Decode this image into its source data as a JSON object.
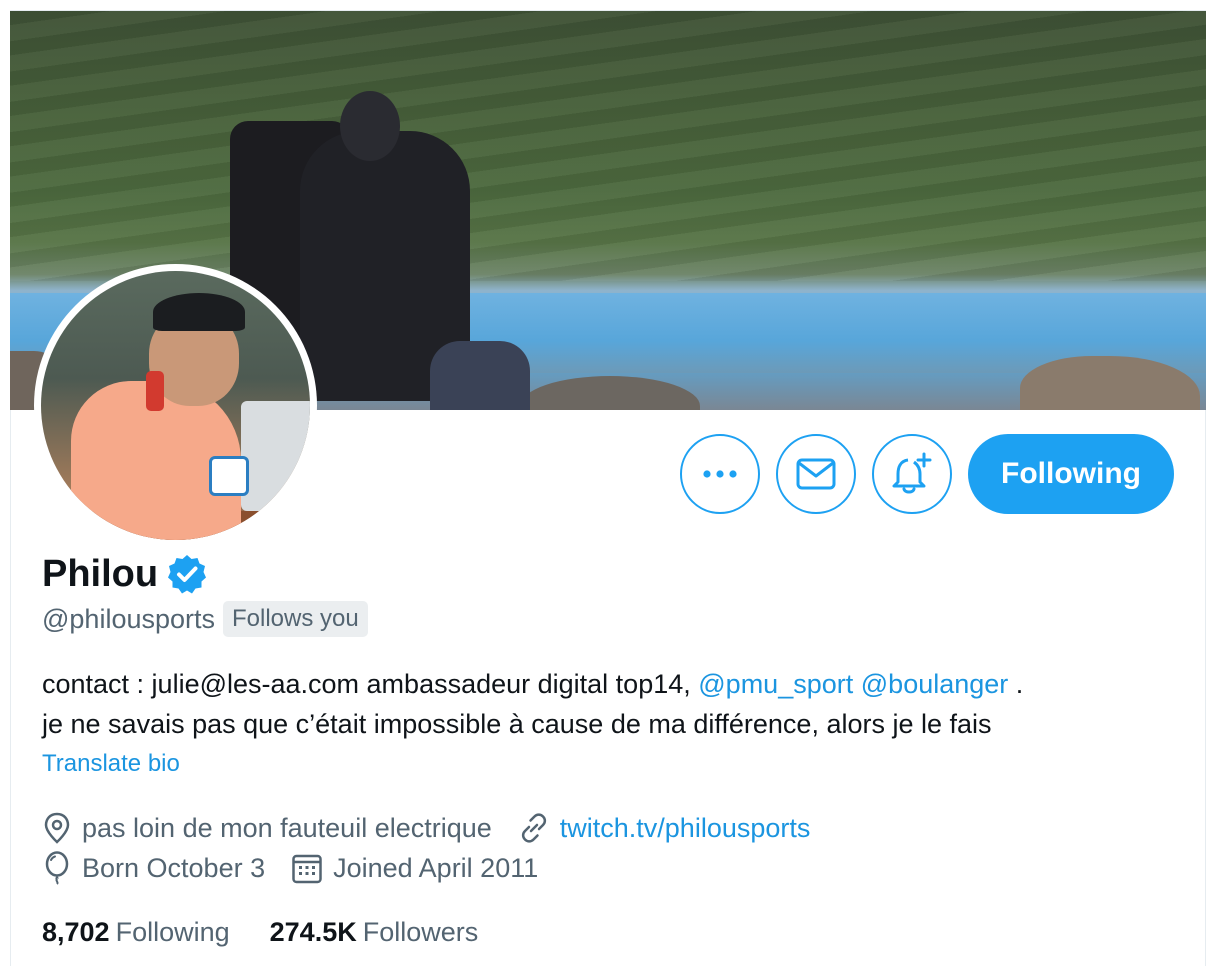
{
  "profile": {
    "name": "Philou",
    "handle": "@philousports",
    "follows_you": "Follows you",
    "verified": true,
    "bio": {
      "text_before": "contact : julie@les-aa.com ambassadeur digital top14, ",
      "mention1": "@pmu_sport",
      "mention2": "@boulanger",
      "text_after": " .",
      "line2": "je ne savais pas que c’était impossible à cause de ma différence, alors je le fais"
    },
    "translate_label": "Translate bio",
    "location": "pas loin de mon fauteuil electrique",
    "website": "twitch.tv/philousports",
    "birthday": "Born October 3",
    "joined": "Joined April 2011"
  },
  "actions": {
    "more_icon": "more-icon",
    "message_icon": "mail-icon",
    "notify_icon": "bell-plus-icon",
    "follow_label": "Following"
  },
  "stats": {
    "following_count": "8,702",
    "following_label": "Following",
    "followers_count": "274.5K",
    "followers_label": "Followers"
  },
  "colors": {
    "accent": "#1da1f2",
    "link": "#1b95e0",
    "secondary_text": "#536471"
  }
}
